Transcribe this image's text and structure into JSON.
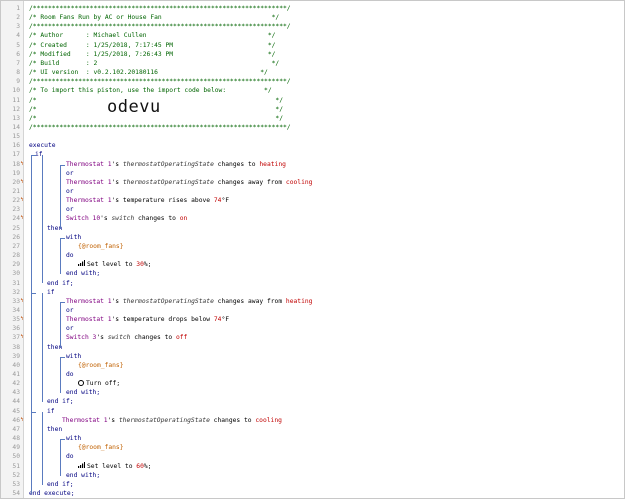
{
  "header": {
    "border": "/*******************************************************************/",
    "title": "/* Room Fans Run by AC or House Fan                             */",
    "author": "/* Author      : Michael Cullen                                */",
    "created": "/* Created     : 1/25/2018, 7:17:45 PM                         */",
    "modified": "/* Modified    : 1/25/2018, 7:26:43 PM                         */",
    "build": "/* Build       : 2                                              */",
    "ui_version": "/* UI version  : v0.2.102.20180116                           */",
    "import_note": "/* To import this piston, use the import code below:          */",
    "blank": "/*                                                               */",
    "import_code": "odevu"
  },
  "line_numbers": [
    "1",
    "2",
    "3",
    "4",
    "5",
    "6",
    "7",
    "8",
    "9",
    "10",
    "11",
    "12",
    "13",
    "14",
    "15",
    "16",
    "17",
    "18",
    "19",
    "20",
    "21",
    "22",
    "23",
    "24",
    "25",
    "26",
    "27",
    "28",
    "29",
    "30",
    "31",
    "32",
    "33",
    "34",
    "35",
    "36",
    "37",
    "38",
    "39",
    "40",
    "41",
    "42",
    "43",
    "44",
    "45",
    "46",
    "47",
    "48",
    "49",
    "50",
    "51",
    "52",
    "53",
    "54"
  ],
  "trigger_mark": "ϟ",
  "keywords": {
    "execute": "execute",
    "if": "if",
    "or": "or",
    "then": "then",
    "with": "with",
    "do": "do",
    "end_with": "end with;",
    "end_if": "end if;",
    "end_execute": "end execute;"
  },
  "code": {
    "dev_thermostat": "Thermostat 1",
    "dev_switch10": "Switch 10",
    "dev_switch3": "Switch 3",
    "possessive": "'s ",
    "attr_opstate": "thermostatOperatingState",
    "attr_switch": "switch",
    "attr_temp": "temperature",
    "changes_to": " changes to ",
    "changes_away": " changes away from ",
    "rises_above": " rises above ",
    "drops_below": " drops below ",
    "heating": "heating",
    "cooling": "cooling",
    "on": "on",
    "off": "off",
    "temp_value": "74",
    "temp_unit": "°F",
    "room_fans": "{@room_fans}",
    "set_level": "Set level to ",
    "level_30": "30",
    "level_60": "60",
    "percent_end": "%;",
    "turn_off": "Turn off;"
  },
  "colors": {
    "comment": "#006400",
    "keyword": "#000080",
    "device": "#800080",
    "value": "#c00000",
    "variable": "#c06000",
    "guide": "#5a7bbf"
  }
}
